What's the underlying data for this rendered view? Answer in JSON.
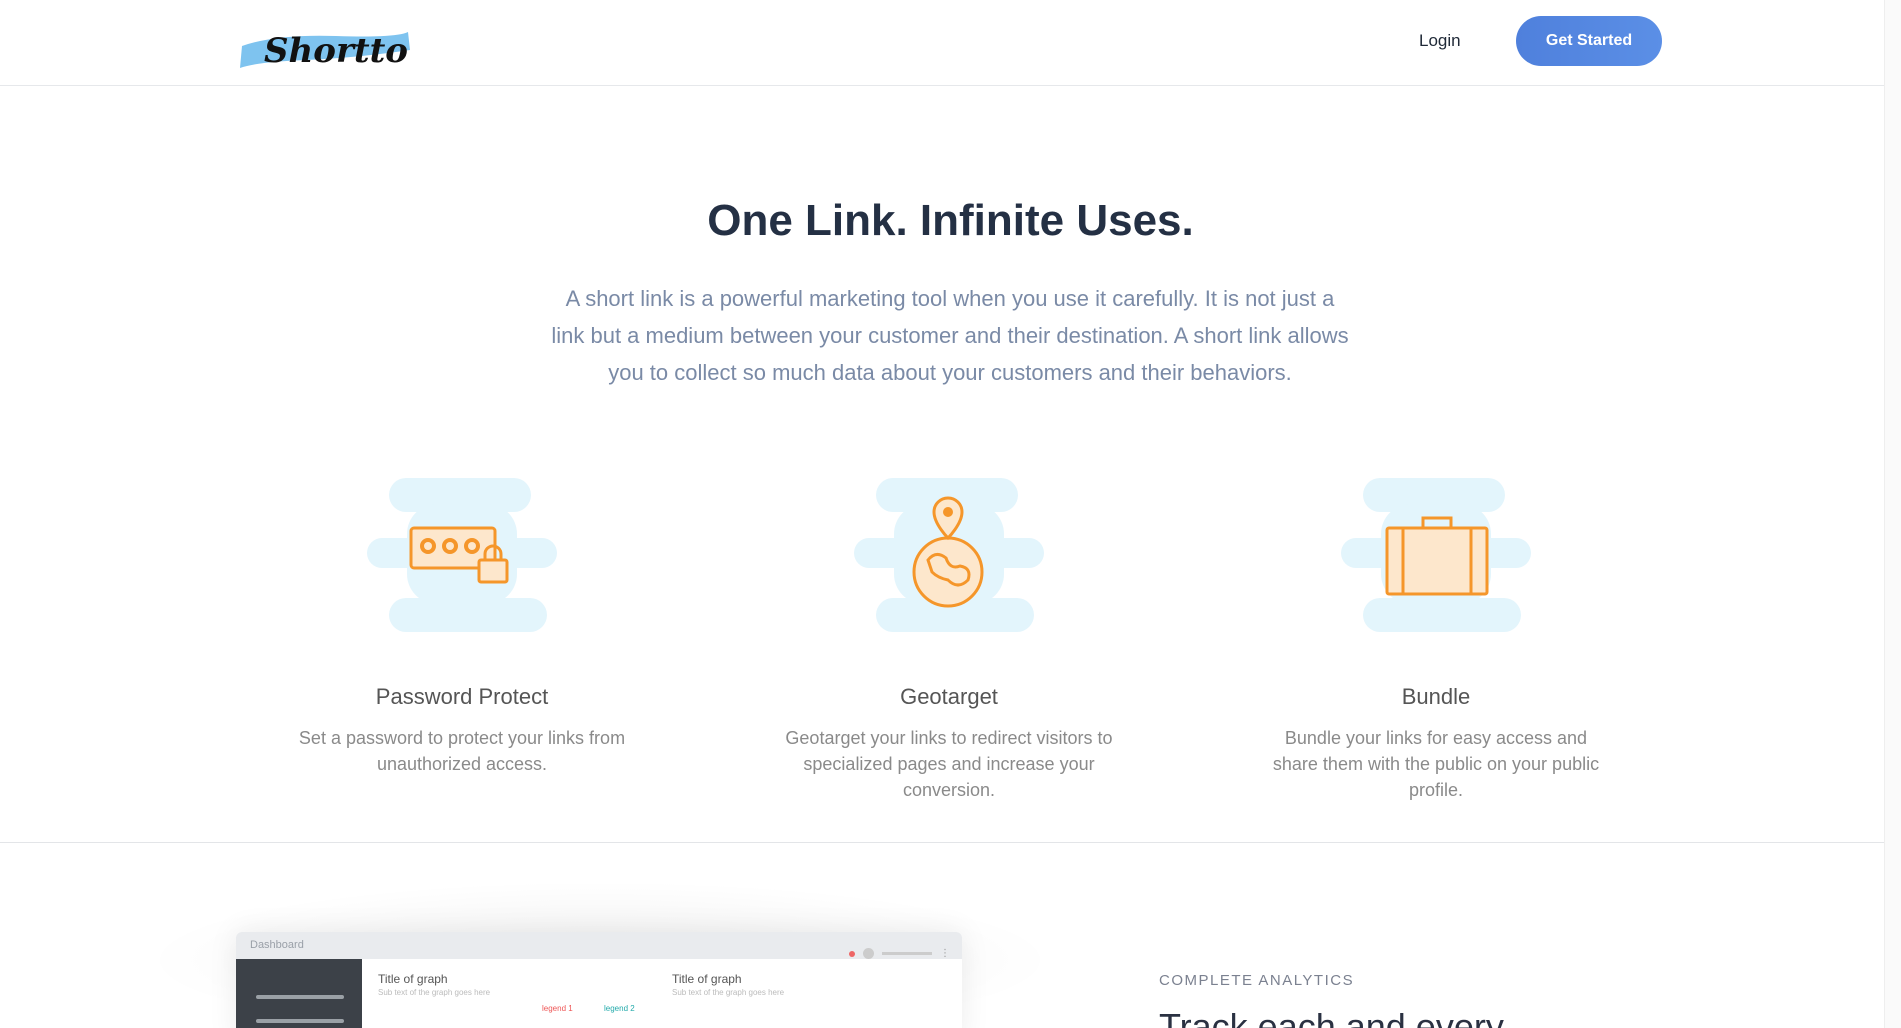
{
  "header": {
    "logo_text": "Shortto",
    "login_label": "Login",
    "cta_label": "Get Started"
  },
  "hero": {
    "title": "One Link. Infinite Uses.",
    "text": "A short link is a powerful marketing tool when you use it carefully. It is not just a link but a medium between your customer and their destination. A short link allows you to collect so much data about your customers and their behaviors."
  },
  "features": [
    {
      "icon": "password-protect-icon",
      "title": "Password Protect",
      "text": "Set a password to protect your links from unauthorized access."
    },
    {
      "icon": "geotarget-icon",
      "title": "Geotarget",
      "text": "Geotarget your links to redirect visitors to specialized pages and increase your conversion."
    },
    {
      "icon": "briefcase-icon",
      "title": "Bundle",
      "text": "Bundle your links for easy access and share them with the public on your public profile."
    }
  ],
  "dashboard": {
    "window_title": "Dashboard",
    "graph1_title": "Title of graph",
    "graph1_sub": "Sub text of the graph goes here",
    "graph2_title": "Title of graph",
    "graph2_sub": "Sub text of the graph goes here",
    "legend1": "legend 1",
    "legend2": "legend 2"
  },
  "analytics": {
    "label": "COMPLETE ANALYTICS",
    "title": "Track each and every"
  },
  "colors": {
    "accent": "#5b8fe6",
    "icon_orange": "#f5962a",
    "icon_blob": "#e3f5fc"
  }
}
